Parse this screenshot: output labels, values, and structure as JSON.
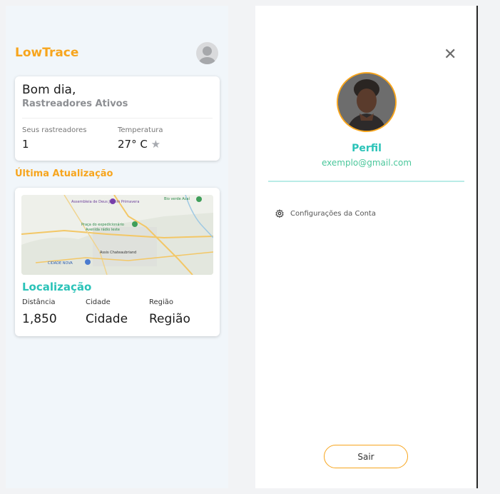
{
  "app": {
    "brand": "LowTrace"
  },
  "greeting": {
    "title": "Bom dia,",
    "subtitle": "Rastreadores Ativos"
  },
  "stats": [
    {
      "label": "Seus rastreadores",
      "value": "1"
    },
    {
      "label": "Temperatura",
      "value": "27° C"
    }
  ],
  "last_update": {
    "title": "Última Atualização"
  },
  "map": {
    "labels": [
      "Assembleia de Deus Jardim Primavera",
      "Praça do expedicionário",
      "Avenida rádio leste",
      "Assis Chateaubriand",
      "Bio verde Acaí",
      "CIDADE NOVA"
    ]
  },
  "location": {
    "title": "Localização",
    "fields": [
      {
        "label": "Distância",
        "value": "1,850"
      },
      {
        "label": "Cidade",
        "value": "Cidade"
      },
      {
        "label": "Região",
        "value": "Região"
      }
    ]
  },
  "profile_panel": {
    "title": "Perfil",
    "email": "exemplo@gmail.com",
    "settings_label": "Configurações da Conta",
    "logout_label": "Sair"
  },
  "colors": {
    "accent": "#f7a51d",
    "teal": "#2bc3b8",
    "email_green": "#4ac79b"
  }
}
